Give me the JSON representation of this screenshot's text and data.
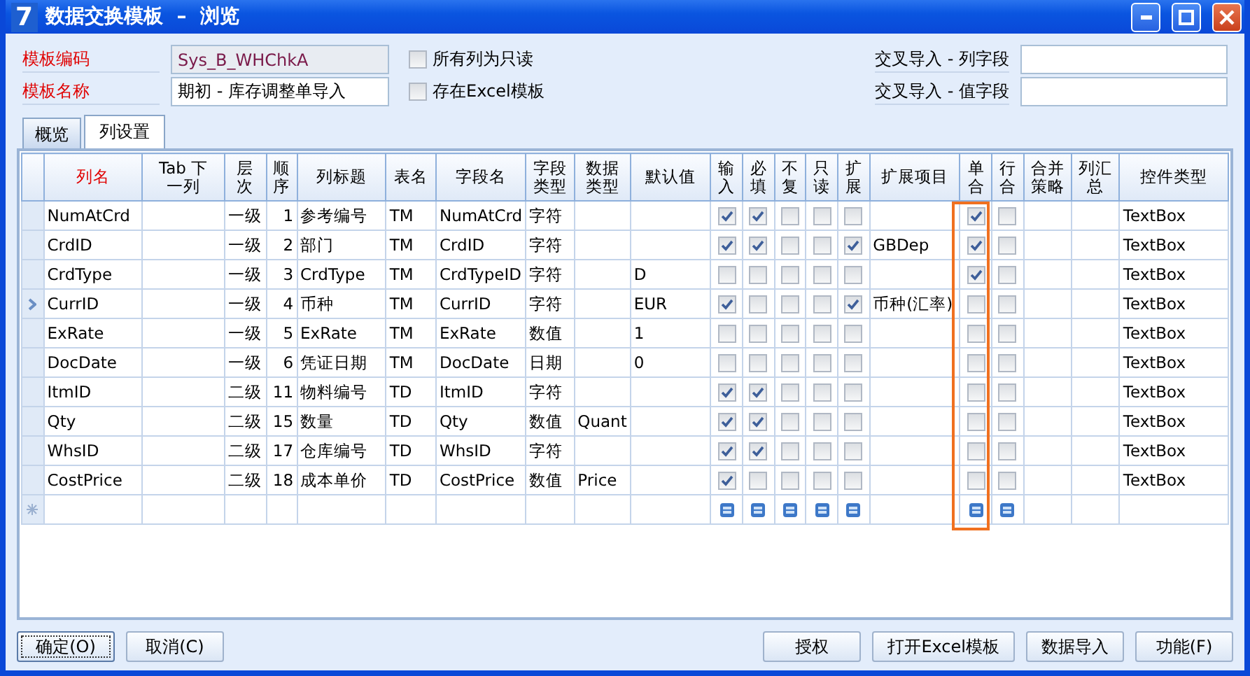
{
  "window": {
    "logo": "7",
    "title": "数据交换模板  –  浏览"
  },
  "form": {
    "code_label": "模板编码",
    "code_value": "Sys_B_WHChkA",
    "name_label": "模板名称",
    "name_value": "期初 - 库存调整单导入",
    "options": [
      {
        "label": "所有列为只读",
        "checked": false
      },
      {
        "label": "存在Excel模板",
        "checked": false
      }
    ],
    "cross": [
      {
        "label": "交叉导入 - 列字段"
      },
      {
        "label": "交叉导入 - 值字段"
      }
    ]
  },
  "tabs": [
    {
      "label": "概览",
      "selected": false
    },
    {
      "label": "列设置",
      "selected": true
    }
  ],
  "table": {
    "columns": [
      {
        "label": "列名",
        "kind": "text",
        "required": true,
        "highlighted": false
      },
      {
        "label": "Tab 下一列",
        "kind": "text",
        "required": false,
        "highlighted": false
      },
      {
        "label": "层次",
        "kind": "text",
        "required": false,
        "highlighted": false
      },
      {
        "label": "顺序",
        "kind": "num",
        "required": false,
        "highlighted": false
      },
      {
        "label": "列标题",
        "kind": "text",
        "required": false,
        "highlighted": false
      },
      {
        "label": "表名",
        "kind": "text",
        "required": false,
        "highlighted": false
      },
      {
        "label": "字段名",
        "kind": "text",
        "required": false,
        "highlighted": false
      },
      {
        "label": "字段类型",
        "kind": "text",
        "required": false,
        "highlighted": false
      },
      {
        "label": "数据类型",
        "kind": "text",
        "required": false,
        "highlighted": false
      },
      {
        "label": "默认值",
        "kind": "text",
        "required": false,
        "highlighted": false
      },
      {
        "label": "输入",
        "kind": "check",
        "required": false,
        "highlighted": false
      },
      {
        "label": "必填",
        "kind": "check",
        "required": false,
        "highlighted": false
      },
      {
        "label": "不复",
        "kind": "check",
        "required": false,
        "highlighted": false
      },
      {
        "label": "只读",
        "kind": "check",
        "required": false,
        "highlighted": false
      },
      {
        "label": "扩展",
        "kind": "check",
        "required": false,
        "highlighted": false
      },
      {
        "label": "扩展项目",
        "kind": "text",
        "required": false,
        "highlighted": false
      },
      {
        "label": "单合",
        "kind": "check",
        "required": false,
        "highlighted": true
      },
      {
        "label": "行合",
        "kind": "check",
        "required": false,
        "highlighted": false
      },
      {
        "label": "合并策略",
        "kind": "text",
        "required": false,
        "highlighted": false
      },
      {
        "label": "列汇总",
        "kind": "text",
        "required": false,
        "highlighted": false
      },
      {
        "label": "控件类型",
        "kind": "text",
        "required": false,
        "highlighted": false
      }
    ],
    "rows": [
      {
        "current": false,
        "cells": [
          "NumAtCrd",
          "",
          "一级",
          "1",
          "参考编号",
          "TM",
          "NumAtCrd",
          "字符",
          "",
          "",
          true,
          true,
          false,
          false,
          false,
          "",
          true,
          false,
          "",
          "",
          "TextBox"
        ]
      },
      {
        "current": false,
        "cells": [
          "CrdID",
          "",
          "一级",
          "2",
          "部门",
          "TM",
          "CrdID",
          "字符",
          "",
          "",
          true,
          true,
          false,
          false,
          true,
          "GBDep",
          true,
          false,
          "",
          "",
          "TextBox"
        ]
      },
      {
        "current": false,
        "cells": [
          "CrdType",
          "",
          "一级",
          "3",
          "CrdType",
          "TM",
          "CrdTypeID",
          "字符",
          "",
          "D",
          false,
          false,
          false,
          false,
          false,
          "",
          true,
          false,
          "",
          "",
          "TextBox"
        ]
      },
      {
        "current": true,
        "cells": [
          "CurrID",
          "",
          "一级",
          "4",
          "币种",
          "TM",
          "CurrID",
          "字符",
          "",
          "EUR",
          true,
          false,
          false,
          false,
          true,
          "币种(汇率)",
          false,
          false,
          "",
          "",
          "TextBox"
        ]
      },
      {
        "current": false,
        "cells": [
          "ExRate",
          "",
          "一级",
          "5",
          "ExRate",
          "TM",
          "ExRate",
          "数值",
          "",
          "1",
          false,
          false,
          false,
          false,
          false,
          "",
          false,
          false,
          "",
          "",
          "TextBox"
        ]
      },
      {
        "current": false,
        "cells": [
          "DocDate",
          "",
          "一级",
          "6",
          "凭证日期",
          "TM",
          "DocDate",
          "日期",
          "",
          "0",
          false,
          false,
          false,
          false,
          false,
          "",
          false,
          false,
          "",
          "",
          "TextBox"
        ]
      },
      {
        "current": false,
        "cells": [
          "ItmID",
          "",
          "二级",
          "11",
          "物料编号",
          "TD",
          "ItmID",
          "字符",
          "",
          "",
          true,
          true,
          false,
          false,
          false,
          "",
          false,
          false,
          "",
          "",
          "TextBox"
        ]
      },
      {
        "current": false,
        "cells": [
          "Qty",
          "",
          "二级",
          "15",
          "数量",
          "TD",
          "Qty",
          "数值",
          "Quant",
          "",
          true,
          true,
          false,
          false,
          false,
          "",
          false,
          false,
          "",
          "",
          "TextBox"
        ]
      },
      {
        "current": false,
        "cells": [
          "WhsID",
          "",
          "二级",
          "17",
          "仓库编号",
          "TD",
          "WhsID",
          "字符",
          "",
          "",
          true,
          true,
          false,
          false,
          false,
          "",
          false,
          false,
          "",
          "",
          "TextBox"
        ]
      },
      {
        "current": false,
        "cells": [
          "CostPrice",
          "",
          "二级",
          "18",
          "成本单价",
          "TD",
          "CostPrice",
          "数值",
          "Price",
          "",
          true,
          false,
          false,
          false,
          false,
          "",
          false,
          false,
          "",
          "",
          "TextBox"
        ]
      }
    ]
  },
  "buttons_left": [
    {
      "label": "确定(O)",
      "focused": true
    },
    {
      "label": "取消(C)",
      "focused": false
    }
  ],
  "buttons_right": [
    {
      "label": "授权",
      "focused": false
    },
    {
      "label": "打开Excel模板",
      "focused": false
    },
    {
      "label": "数据导入",
      "focused": false
    },
    {
      "label": "功能(F)",
      "focused": false
    }
  ]
}
